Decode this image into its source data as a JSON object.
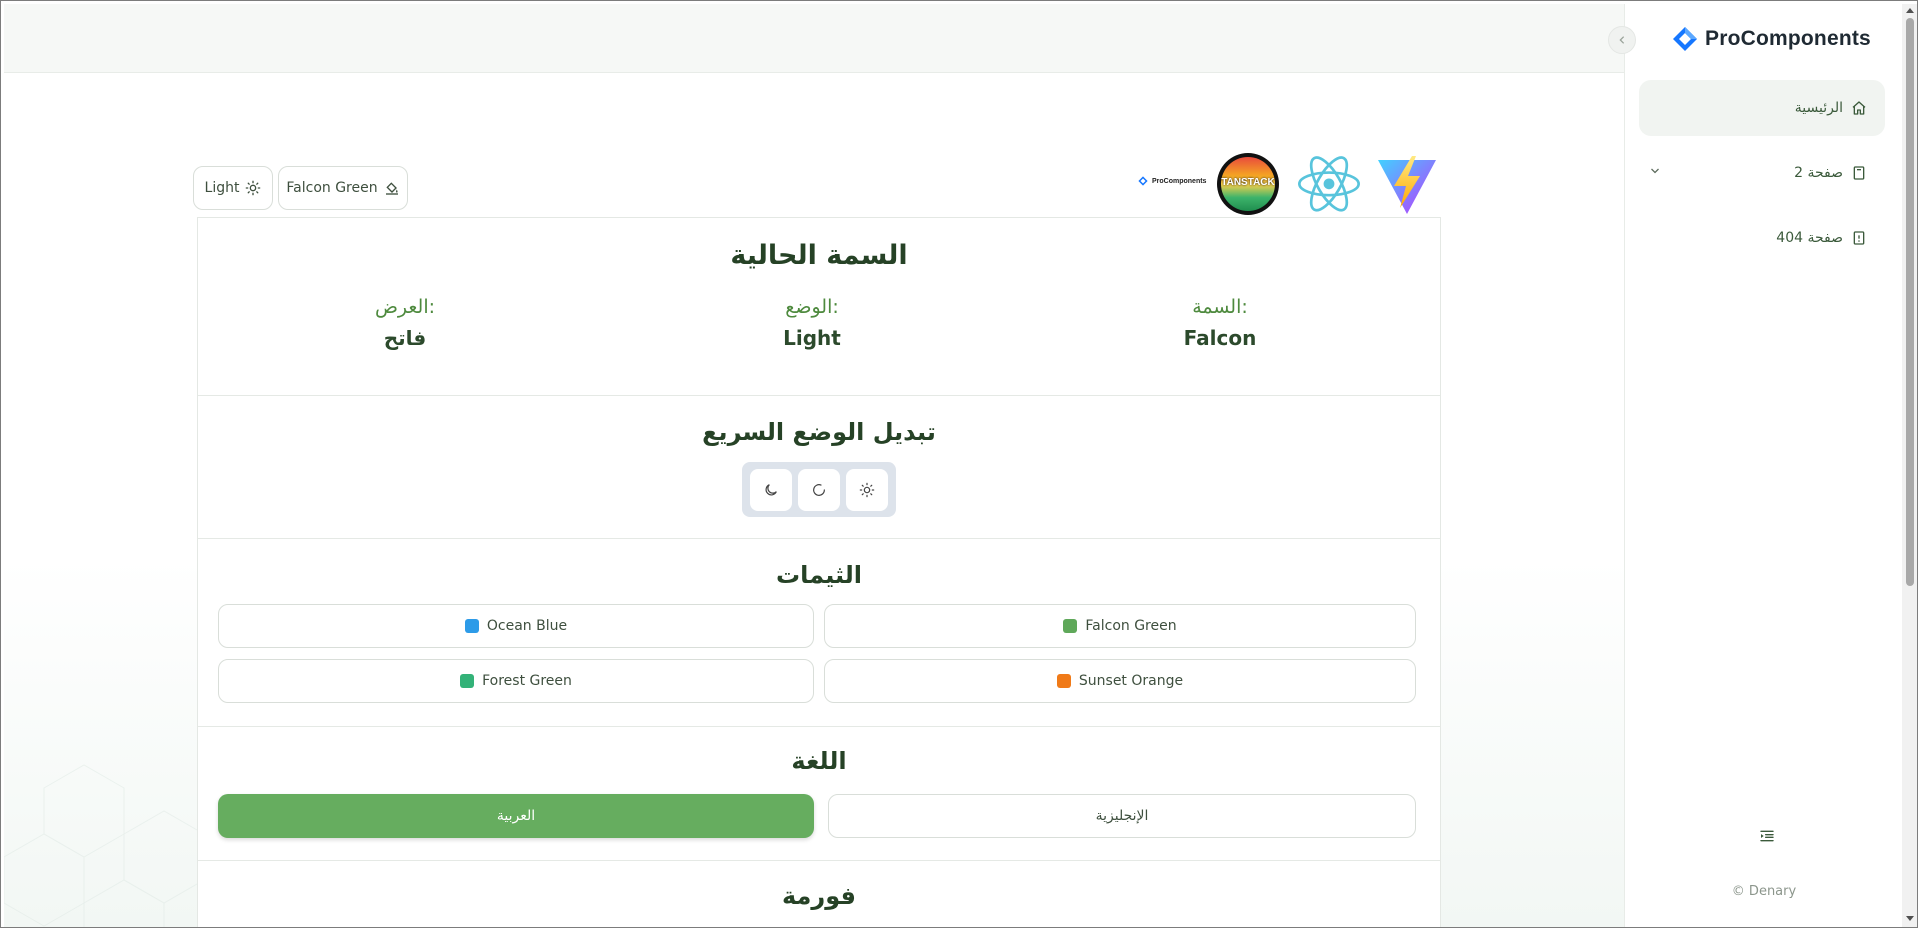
{
  "sidebar": {
    "brand": "ProComponents",
    "items": [
      {
        "label": "الرئيسية",
        "icon": "home-icon"
      },
      {
        "label": "صفحة 2",
        "icon": "document-icon"
      },
      {
        "label": "صفحة 404",
        "icon": "file-warning-icon"
      }
    ],
    "copyright": "© Denary"
  },
  "toolbar": {
    "mode_label": "Light",
    "theme_label": "Falcon Green",
    "logos": [
      "ProComponents",
      "TANSTACK",
      "React",
      "Vite"
    ]
  },
  "current_theme": {
    "title": "السمة الحالية",
    "theme_label": "السمة:",
    "theme_value": "Falcon",
    "mode_label": "الوضع:",
    "mode_value": "Light",
    "display_label": "العرض:",
    "display_value": "فاتح"
  },
  "quick_mode": {
    "title": "تبديل الوضع السريع",
    "options": [
      "dark",
      "system",
      "light"
    ]
  },
  "themes": {
    "title": "الثيمات",
    "items": [
      {
        "label": "Falcon Green",
        "color": "#5fa85a"
      },
      {
        "label": "Ocean Blue",
        "color": "#2d9be8"
      },
      {
        "label": "Sunset Orange",
        "color": "#f07a18"
      },
      {
        "label": "Forest Green",
        "color": "#33b278"
      }
    ]
  },
  "language": {
    "title": "اللغة",
    "english": "الإنجليزية",
    "arabic": "العربية"
  },
  "form": {
    "title": "فورمة"
  },
  "colors": {
    "accent": "#66ad5f"
  }
}
